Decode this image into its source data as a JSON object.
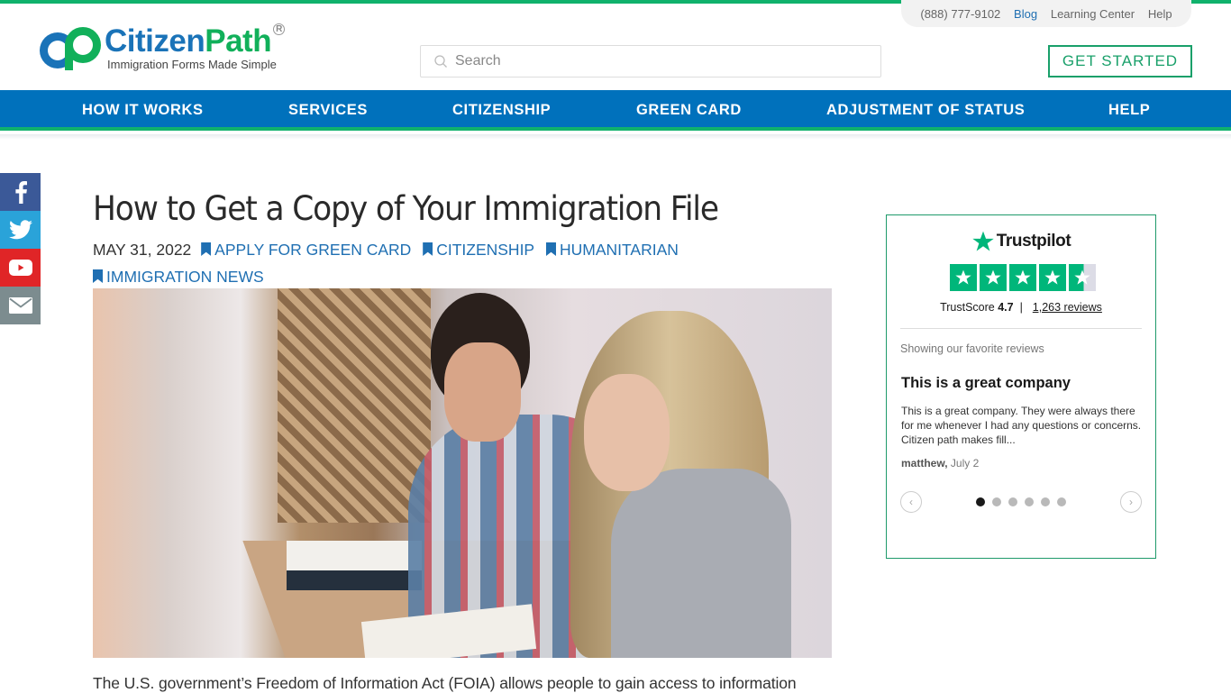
{
  "utility_bar": {
    "phone": "(888) 777-9102",
    "links": [
      "Blog",
      "Learning Center",
      "Help"
    ]
  },
  "logo": {
    "name_part1": "Citizen",
    "name_part2": "Path",
    "registered": "R",
    "tagline": "Immigration Forms Made Simple"
  },
  "search": {
    "placeholder": "Search",
    "value": ""
  },
  "header": {
    "cta_label": "GET STARTED"
  },
  "nav": {
    "items": [
      "HOW IT WORKS",
      "SERVICES",
      "CITIZENSHIP",
      "GREEN CARD",
      "ADJUSTMENT OF STATUS",
      "HELP"
    ]
  },
  "social": {
    "icons": [
      "facebook-icon",
      "twitter-icon",
      "youtube-icon",
      "email-icon"
    ]
  },
  "article": {
    "title": "How to Get a Copy of Your Immigration File",
    "date": "MAY 31, 2022",
    "categories": [
      "APPLY FOR GREEN CARD",
      "CITIZENSHIP",
      "HUMANITARIAN",
      "IMMIGRATION NEWS"
    ],
    "hero_alt": "Couple reading a book together at a cafe table",
    "intro": "The U.S. government’s Freedom of Information Act (FOIA) allows people to gain access to information"
  },
  "trustpilot": {
    "brand": "Trustpilot",
    "rating": 4.7,
    "stars_filled": 4.5,
    "stars_total": 5,
    "trustscore_label": "TrustScore",
    "trustscore_value": "4.7",
    "separator": "|",
    "reviews_count": "1,263 reviews",
    "showing_label": "Showing our favorite reviews",
    "review": {
      "title": "This is a great company",
      "body": "This is a great company. They were always there for me whenever I had any questions or concerns. Citizen path makes fill...",
      "author": "matthew,",
      "date": "July 2"
    },
    "carousel": {
      "total_slides": 6,
      "active_slide": 1,
      "prev_glyph": "‹",
      "next_glyph": "›"
    },
    "colors": {
      "star_green": "#00b67a",
      "border": "#1e9a6a"
    }
  },
  "colors": {
    "nav_blue": "#0071bc",
    "accent_green": "#10b26c",
    "link_blue": "#1f6fb2"
  }
}
